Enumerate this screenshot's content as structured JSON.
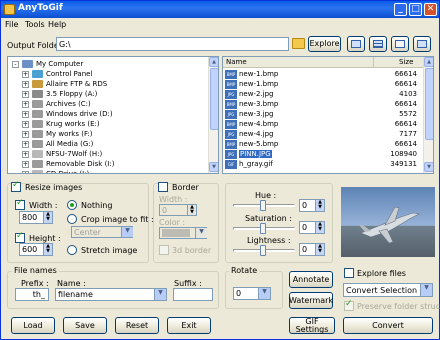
{
  "window": {
    "title": "AnyToGif"
  },
  "menu": [
    "File",
    "Tools",
    "Help"
  ],
  "output": {
    "label": "Output Folder",
    "value": "G:\\",
    "explore": "Explore"
  },
  "tree": [
    {
      "label": "My Computer",
      "depth": 0,
      "expander": "-",
      "icon": "computer-icon",
      "color": "#6b8fc7"
    },
    {
      "label": "Control Panel",
      "depth": 1,
      "expander": "+",
      "icon": "control-panel-icon",
      "color": "#4aa0d0"
    },
    {
      "label": "Allaire FTP & RDS",
      "depth": 1,
      "expander": "+",
      "icon": "network-icon",
      "color": "#c89a3c"
    },
    {
      "label": "3.5 Floppy (A:)",
      "depth": 1,
      "expander": "+",
      "icon": "floppy-icon",
      "color": "#8a8a8a"
    },
    {
      "label": "Archives (C:)",
      "depth": 1,
      "expander": "+",
      "icon": "drive-icon",
      "color": "#9a9a9a"
    },
    {
      "label": "Windows drive (D:)",
      "depth": 1,
      "expander": "+",
      "icon": "drive-icon",
      "color": "#9a9a9a"
    },
    {
      "label": "Krug works (E:)",
      "depth": 1,
      "expander": "+",
      "icon": "drive-icon",
      "color": "#9a9a9a"
    },
    {
      "label": "My works (F:)",
      "depth": 1,
      "expander": "+",
      "icon": "drive-icon",
      "color": "#9a9a9a"
    },
    {
      "label": "All Media (G:)",
      "depth": 1,
      "expander": "+",
      "icon": "drive-icon",
      "color": "#9a9a9a"
    },
    {
      "label": "NFSU-7Wolf (H:)",
      "depth": 1,
      "expander": "+",
      "icon": "cd-icon",
      "color": "#b8b8b8"
    },
    {
      "label": "Removable Disk (I:)",
      "depth": 1,
      "expander": "+",
      "icon": "drive-icon",
      "color": "#9a9a9a"
    },
    {
      "label": "CD Drive (J:)",
      "depth": 1,
      "expander": "+",
      "icon": "cd-icon",
      "color": "#b8b8b8"
    }
  ],
  "filelist": {
    "col_name": "Name",
    "col_size": "Size",
    "rows": [
      {
        "name": "new-1.bmp",
        "size": "66614",
        "type": "BMP"
      },
      {
        "name": "new-1.bmp",
        "size": "66614",
        "type": "BMP"
      },
      {
        "name": "new-2.jpg",
        "size": "4103",
        "type": "JPG"
      },
      {
        "name": "new-3.bmp",
        "size": "66614",
        "type": "BMP"
      },
      {
        "name": "new-3.jpg",
        "size": "5572",
        "type": "JPG"
      },
      {
        "name": "new-4.bmp",
        "size": "66614",
        "type": "BMP"
      },
      {
        "name": "new-4.jpg",
        "size": "7177",
        "type": "JPG"
      },
      {
        "name": "new-5.bmp",
        "size": "66614",
        "type": "BMP"
      },
      {
        "name": "PINN.JPG",
        "size": "108940",
        "type": "JPG"
      },
      {
        "name": "h_gray.gif",
        "size": "349131",
        "type": "GIF"
      }
    ],
    "selected_index": 8
  },
  "resize": {
    "group": "Resize images",
    "width_label": "Width :",
    "width_value": "800",
    "height_label": "Height :",
    "height_value": "600",
    "opt_nothing": "Nothing",
    "opt_crop": "Crop image to fit :",
    "crop_value": "Center",
    "opt_stretch": "Stretch image"
  },
  "border": {
    "group": "Border",
    "width_label": "Width :",
    "width_value": "0",
    "color_label": "Color :",
    "opt_3d": "3d border"
  },
  "adjust": {
    "hue_label": "Hue :",
    "hue_value": "0",
    "sat_label": "Saturation :",
    "sat_value": "0",
    "light_label": "Lightness :",
    "light_value": "0"
  },
  "filenames": {
    "group": "File names",
    "prefix_label": "Prefix :",
    "prefix_value": "th_",
    "name_label": "Name :",
    "name_value": "filename",
    "suffix_label": "Suffix :",
    "suffix_value": ""
  },
  "rotate": {
    "group": "Rotate",
    "value": "0"
  },
  "actions": {
    "annotate": "Annotate",
    "watermark": "Watermark",
    "gif_settings": "GIF Settings",
    "convert": "Convert",
    "load": "Load",
    "save": "Save",
    "reset": "Reset",
    "exit": "Exit"
  },
  "explore_files": {
    "label": "Explore files",
    "selection": "Convert Selection",
    "preserve": "Preserve folder structure"
  }
}
